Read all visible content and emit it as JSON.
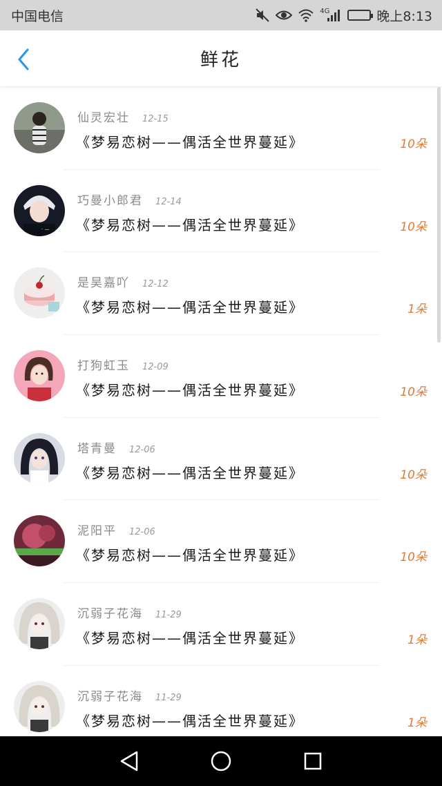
{
  "status_bar": {
    "carrier": "中国电信",
    "network": "4G",
    "time": "晚上8:13",
    "icons": [
      "mute-icon",
      "eye-icon",
      "wifi-icon",
      "signal-icon",
      "battery-icon"
    ]
  },
  "nav": {
    "title": "鲜花",
    "back_icon": "chevron-left-icon",
    "accent_color": "#2196f3"
  },
  "list": {
    "items": [
      {
        "name": "仙灵宏壮",
        "date": "12-15",
        "title": "《梦易恋树——偶活全世界蔓延》",
        "count": "10朵",
        "avatar": "girl-photo"
      },
      {
        "name": "巧曼小郎君",
        "date": "12-14",
        "title": "《梦易恋树——偶活全世界蔓延》",
        "count": "10朵",
        "avatar": "boy-photo"
      },
      {
        "name": "是昊嘉吖",
        "date": "12-12",
        "title": "《梦易恋树——偶活全世界蔓延》",
        "count": "1朵",
        "avatar": "cake-photo"
      },
      {
        "name": "打狗虹玉",
        "date": "12-09",
        "title": "《梦易恋树——偶活全世界蔓延》",
        "count": "10朵",
        "avatar": "cartoon-girl"
      },
      {
        "name": "塔青曼",
        "date": "12-06",
        "title": "《梦易恋树——偶活全世界蔓延》",
        "count": "10朵",
        "avatar": "anime-girl"
      },
      {
        "name": "泥阳平",
        "date": "12-06",
        "title": "《梦易恋树——偶活全世界蔓延》",
        "count": "10朵",
        "avatar": "rose-photo"
      },
      {
        "name": "沉弱子花海",
        "date": "11-29",
        "title": "《梦易恋树——偶活全世界蔓延》",
        "count": "1朵",
        "avatar": "anime-white-hair"
      },
      {
        "name": "沉弱子花海",
        "date": "11-29",
        "title": "《梦易恋树——偶活全世界蔓延》",
        "count": "1朵",
        "avatar": "anime-white-hair"
      }
    ]
  },
  "colors": {
    "count": "#e07a34",
    "name": "#8a8a8a",
    "status_bar_bg": "#d6d6d6"
  },
  "android_nav": {
    "icons": [
      "back-triangle-icon",
      "home-circle-icon",
      "recents-square-icon"
    ]
  }
}
